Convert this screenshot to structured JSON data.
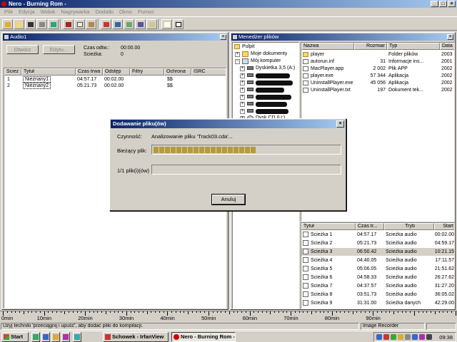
{
  "window": {
    "title": "Nero - Burning Rom -"
  },
  "menu": [
    "Plik",
    "Edycja",
    "Widok",
    "Nagrywarka",
    "Dodatki",
    "Okno",
    "Pomoc"
  ],
  "audio_panel": {
    "title": "Audio1",
    "open_button": "Otwórz",
    "edit_button": "Edytu...",
    "total_time_label": "Czas odtw.:",
    "total_time": "00:00.00",
    "tracks_label": "Ścieżka:",
    "tracks_value": "0",
    "columns": [
      "Ścież",
      "Tytuł",
      "Czas trwa",
      "Odstęp",
      "Filtry",
      "Ochrona",
      "ISRC"
    ],
    "rows": [
      {
        "num": "1",
        "title": "Nieznany1",
        "duration": "04:57.17",
        "gap": "00:02.00",
        "filters": "",
        "protect": "$$",
        "isrc": ""
      },
      {
        "num": "2",
        "title": "Nieznany2",
        "duration": "05:21.73",
        "gap": "00:02.00",
        "filters": "",
        "protect": "$$",
        "isrc": ""
      }
    ]
  },
  "file_manager": {
    "title": "Menedżer plików",
    "tree": {
      "root": "Pulpit",
      "items": [
        "Moje dokumenty",
        "Mój komputer",
        "Dyskietka 3,5 (A:)",
        "Dysk CD (U:)"
      ]
    },
    "file_columns": [
      "Nazwa",
      "Rozmiar",
      "Typ",
      "Data"
    ],
    "files": [
      {
        "name": "player",
        "size": "",
        "type": "Folder plików",
        "date": "2003"
      },
      {
        "name": "autorun.inf",
        "size": "31",
        "type": "Informacje ins...",
        "date": "2001"
      },
      {
        "name": "MacPlayer.app",
        "size": "2 002",
        "type": "Plik APP",
        "date": "2002"
      },
      {
        "name": "player.exe",
        "size": "57 344",
        "type": "Aplikacja",
        "date": "2002"
      },
      {
        "name": "UninstallPlayer.exe",
        "size": "45 056",
        "type": "Aplikacja",
        "date": "2002"
      },
      {
        "name": "UninstallPlayer.txt",
        "size": "197",
        "type": "Dokument tek...",
        "date": "2002"
      }
    ],
    "track_columns": [
      "Tytuł",
      "Czas tr...",
      "Tryb",
      "Start"
    ],
    "tracks": [
      {
        "title": "Ścieżka 1",
        "time": "04:57.17",
        "mode": "Ścieżka audio",
        "start": "00:02.00"
      },
      {
        "title": "Ścieżka 2",
        "time": "05:21.73",
        "mode": "Ścieżka audio",
        "start": "04:59.17"
      },
      {
        "title": "Ścieżka 3",
        "time": "06:50.42",
        "mode": "Ścieżka audio",
        "start": "10:21.15"
      },
      {
        "title": "Ścieżka 4",
        "time": "04:40.05",
        "mode": "Ścieżka audio",
        "start": "17:11.57"
      },
      {
        "title": "Ścieżka 5",
        "time": "05:06.05",
        "mode": "Ścieżka audio",
        "start": "21:51.62"
      },
      {
        "title": "Ścieżka 6",
        "time": "04:58.33",
        "mode": "Ścieżka audio",
        "start": "26:27.62"
      },
      {
        "title": "Ścieżka 7",
        "time": "04:37.57",
        "mode": "Ścieżka audio",
        "start": "31:27.20"
      },
      {
        "title": "Ścieżka 8",
        "time": "03:51.73",
        "mode": "Ścieżka audio",
        "start": "36:05.02"
      },
      {
        "title": "Ścieżka 9",
        "time": "31:31.00",
        "mode": "Ścieżka danych",
        "start": "42:29.00"
      }
    ],
    "selected_track": 2
  },
  "dialog": {
    "title": "Dodawanie pliku(ów)",
    "activity_label": "Czynność:",
    "activity_value": "Analizowanie pliku 'Track03.cda'...",
    "current_label": "Bieżący plik:",
    "current_progress": 0.55,
    "count_label": "1/1 plik(i)(ów)",
    "total_progress": 0,
    "cancel_button": "Anuluj"
  },
  "ruler": [
    "0min",
    "10min",
    "20min",
    "30min",
    "40min",
    "50min",
    "60min",
    "70min",
    "80min",
    "90min"
  ],
  "status": {
    "hint": "Użyj techniki 'przeciągnij i upuść', aby dodać pliki do kompilacji.",
    "recorder": "Image Recorder"
  },
  "taskbar": {
    "start": "Start",
    "tasks": [
      "Schowek - IrfanView",
      "Nero - Burning Rom -"
    ],
    "clock": "09:38"
  }
}
